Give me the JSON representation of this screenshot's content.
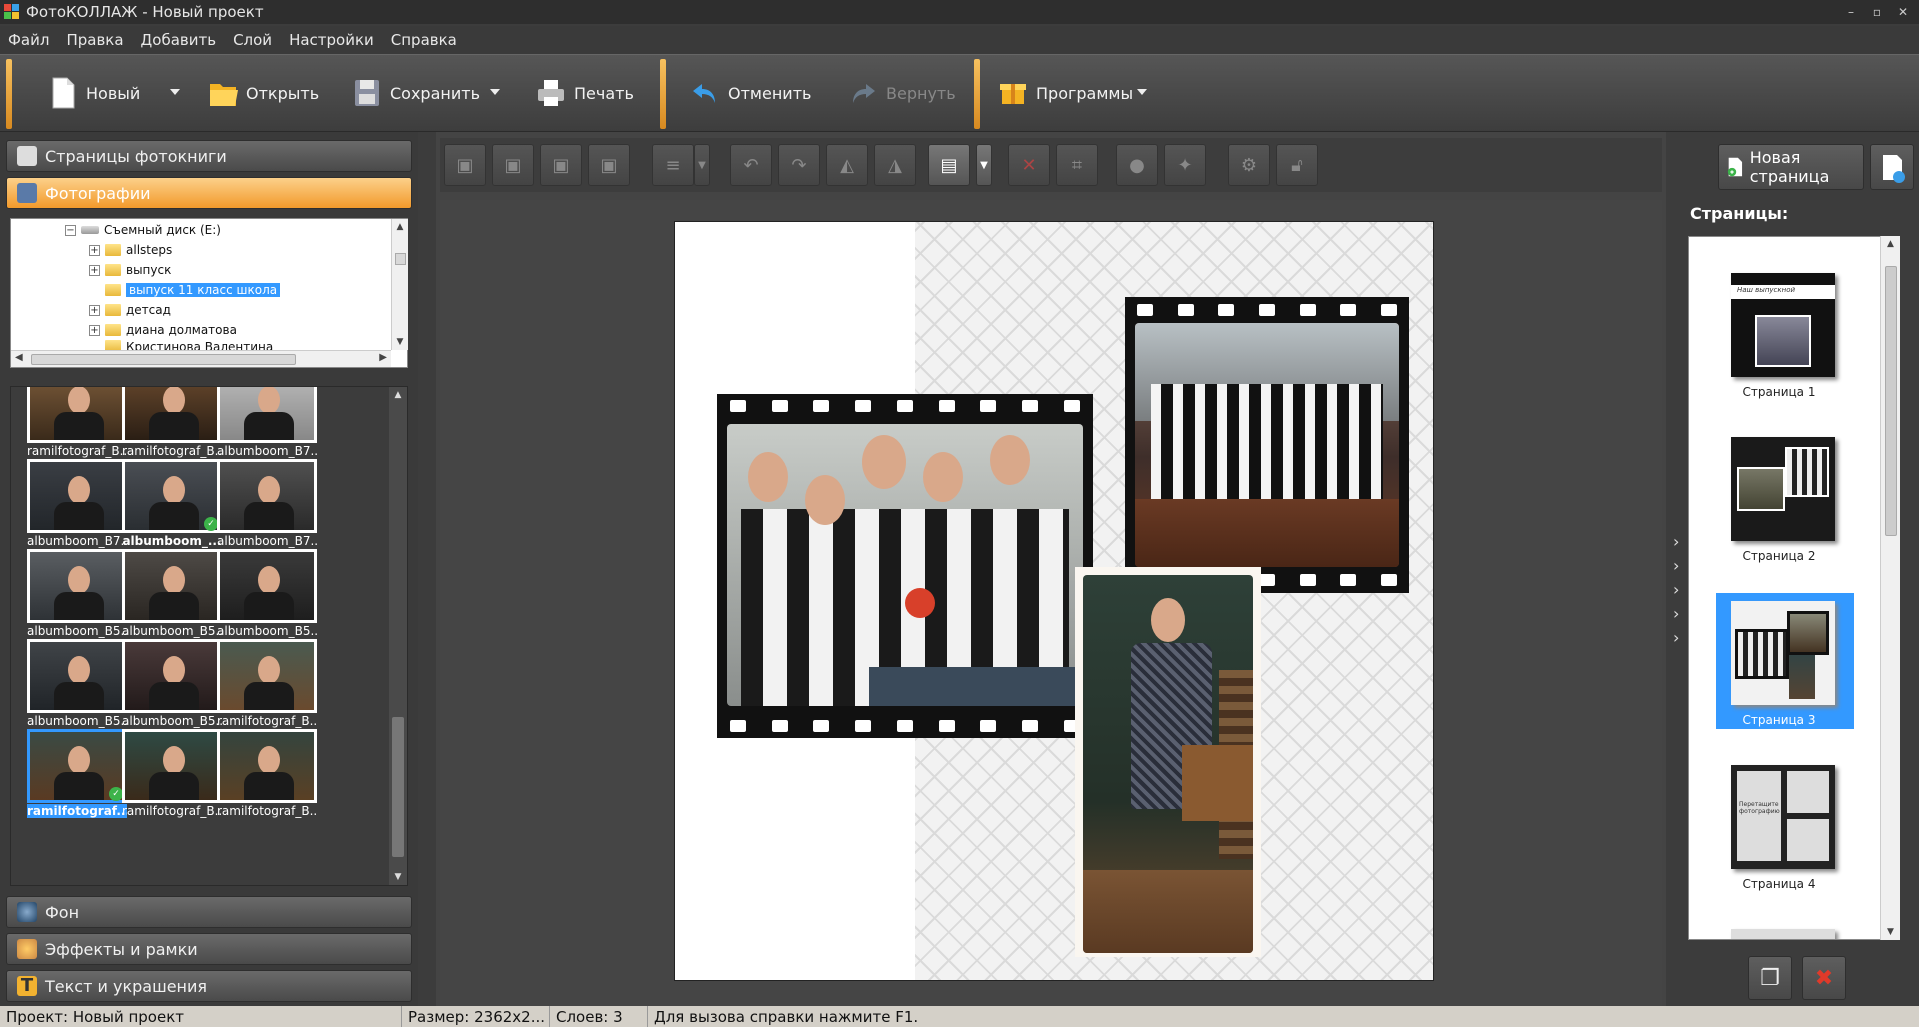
{
  "window": {
    "title": "ФотоКОЛЛАЖ - Новый проект"
  },
  "menu": [
    "Файл",
    "Правка",
    "Добавить",
    "Слой",
    "Настройки",
    "Справка"
  ],
  "toolbar": {
    "new": "Новый",
    "open": "Открыть",
    "save": "Сохранить",
    "print": "Печать",
    "undo": "Отменить",
    "redo": "Вернуть",
    "programs": "Программы"
  },
  "left_panel": {
    "photobook_pages": "Страницы фотокниги",
    "photos": "Фотографии",
    "background": "Фон",
    "effects": "Эффекты и рамки",
    "text": "Текст и украшения"
  },
  "tree": {
    "drive": "Съемный диск (E:)",
    "folders": [
      "allsteps",
      "выпуск",
      "выпуск 11 класс школа",
      "детсад",
      "диана долматова",
      "Кристинова Валентина"
    ],
    "selected_index": 2
  },
  "thumbnails": [
    {
      "caption": "ramilfotograf_B..."
    },
    {
      "caption": "ramilfotograf_B..."
    },
    {
      "caption": "albumboom_B7..."
    },
    {
      "caption": "albumboom_B7..."
    },
    {
      "caption": "albumboom_..."
    },
    {
      "caption": "albumboom_B7..."
    },
    {
      "caption": "albumboom_B5..."
    },
    {
      "caption": "albumboom_B5..."
    },
    {
      "caption": "albumboom_B5..."
    },
    {
      "caption": "albumboom_B5..."
    },
    {
      "caption": "albumboom_B5..."
    },
    {
      "caption": "ramilfotograf_B..."
    },
    {
      "caption": "ramilfotograf..."
    },
    {
      "caption": "ramilfotograf_B..."
    },
    {
      "caption": "ramilfotograf_B..."
    }
  ],
  "right_panel": {
    "new_page": "Новая страница",
    "pages_title": "Страницы:",
    "pages": [
      {
        "caption": "Страница 1",
        "heading": "Наш выпускной"
      },
      {
        "caption": "Страница 2"
      },
      {
        "caption": "Страница 3"
      },
      {
        "caption": "Страница 4",
        "text": "Перетащите фотографию"
      }
    ],
    "selected_page": 3
  },
  "status": {
    "project": "Проект:  Новый проект",
    "size": "Размер:  2362x2...",
    "layers": "Слоев:  3",
    "help": "Для вызова справки нажмите F1."
  },
  "colors": {
    "accent": "#f29a2b",
    "selection": "#3399ff"
  }
}
